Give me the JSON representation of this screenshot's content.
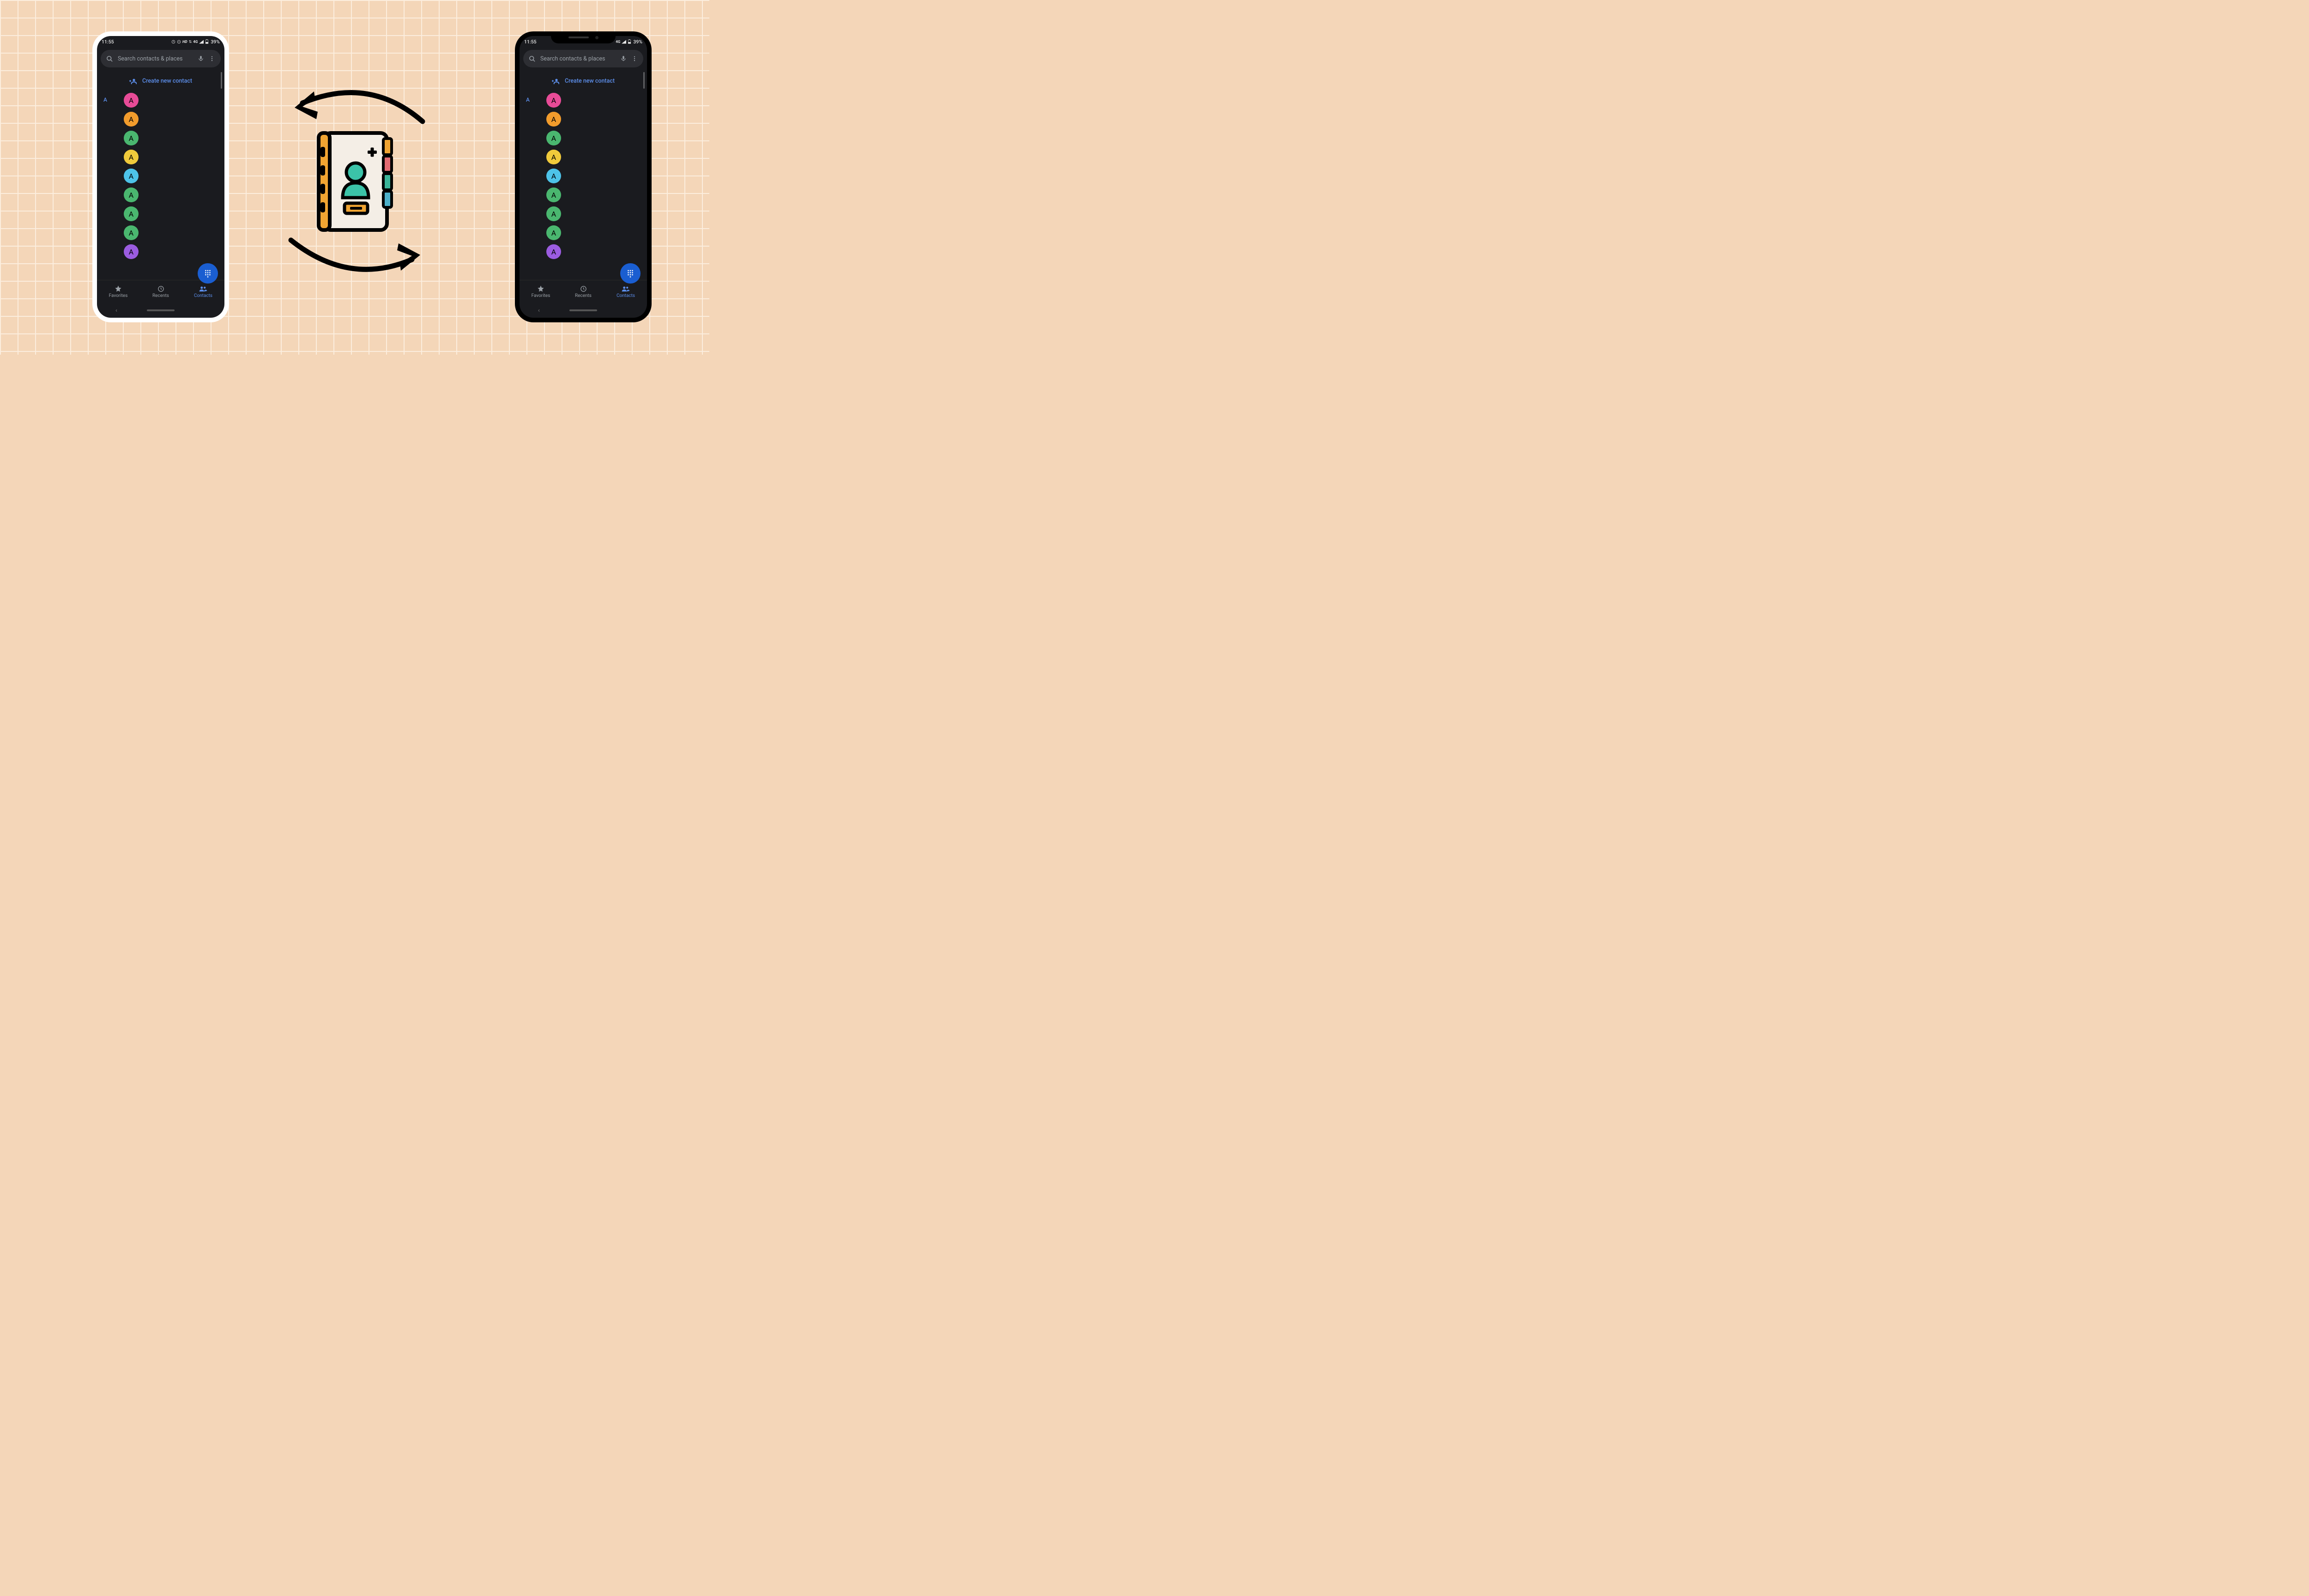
{
  "statusbar": {
    "time": "11:55",
    "hd_label": "HD",
    "network_label": "4G",
    "battery_pct": "39%"
  },
  "search": {
    "placeholder": "Search contacts & places"
  },
  "create": {
    "label": "Create new contact"
  },
  "section_letter": "A",
  "contacts": [
    {
      "letter": "A",
      "color": "#e84b97"
    },
    {
      "letter": "A",
      "color": "#f29c2c"
    },
    {
      "letter": "A",
      "color": "#4ab76f"
    },
    {
      "letter": "A",
      "color": "#f0ca3b"
    },
    {
      "letter": "A",
      "color": "#4dc3e8"
    },
    {
      "letter": "A",
      "color": "#4ab76f"
    },
    {
      "letter": "A",
      "color": "#4ab76f"
    },
    {
      "letter": "A",
      "color": "#4ab76f"
    },
    {
      "letter": "A",
      "color": "#9b5ce0"
    }
  ],
  "nav": {
    "favorites": "Favorites",
    "recents": "Recents",
    "contacts": "Contacts"
  }
}
